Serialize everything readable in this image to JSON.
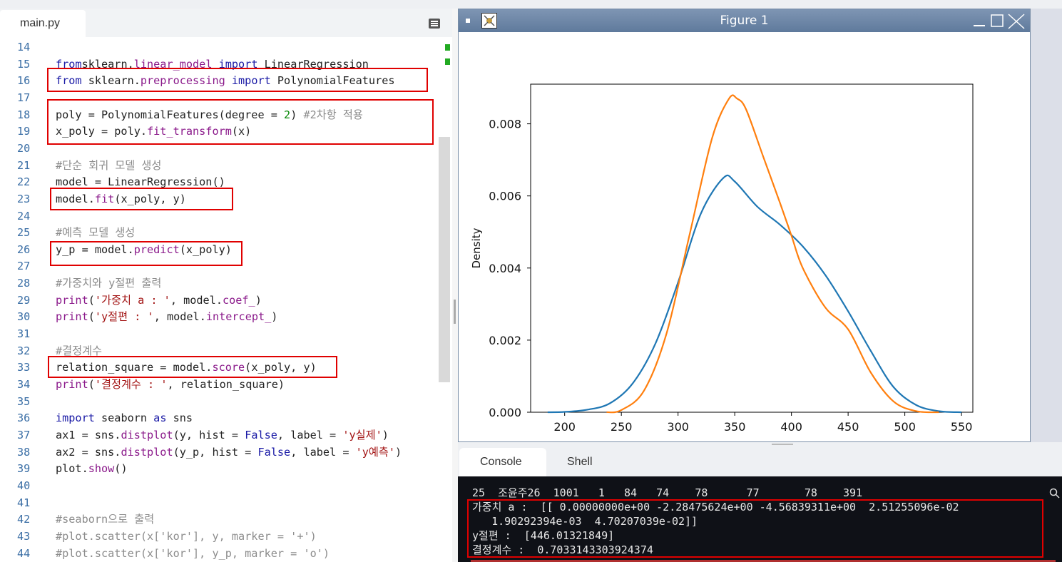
{
  "editor": {
    "tab_label": "main.py",
    "lines": [
      {
        "n": "14",
        "parts": []
      },
      {
        "n": "15",
        "parts": [
          [
            "kw",
            "from"
          ],
          [
            "",
            "sklearn."
          ],
          [
            "fn",
            "linear_model"
          ],
          [
            "",
            ""
          ],
          [
            "kw",
            " import"
          ],
          [
            "",
            " LinearRegression"
          ]
        ]
      },
      {
        "n": "16",
        "parts": [
          [
            "kw",
            "from"
          ],
          [
            "",
            " sklearn."
          ],
          [
            "fn",
            "preprocessing"
          ],
          [
            "kw",
            " import"
          ],
          [
            "",
            " PolynomialFeatures"
          ]
        ]
      },
      {
        "n": "17",
        "parts": []
      },
      {
        "n": "18",
        "parts": [
          [
            "",
            "poly = PolynomialFeatures(degree = "
          ],
          [
            "num",
            "2"
          ],
          [
            "",
            ") "
          ],
          [
            "cm",
            "#2차항 적용"
          ]
        ]
      },
      {
        "n": "19",
        "parts": [
          [
            "",
            "x_poly = poly."
          ],
          [
            "fn",
            "fit_transform"
          ],
          [
            "",
            "(x)"
          ]
        ]
      },
      {
        "n": "20",
        "parts": []
      },
      {
        "n": "21",
        "parts": [
          [
            "cm",
            "#단순 회귀 모델 생성"
          ]
        ]
      },
      {
        "n": "22",
        "parts": [
          [
            "",
            "model = LinearRegression()"
          ]
        ]
      },
      {
        "n": "23",
        "parts": [
          [
            "",
            "model."
          ],
          [
            "fn",
            "fit"
          ],
          [
            "",
            "(x_poly, y)"
          ]
        ]
      },
      {
        "n": "24",
        "parts": []
      },
      {
        "n": "25",
        "parts": [
          [
            "cm",
            "#예측 모델 생성"
          ]
        ]
      },
      {
        "n": "26",
        "parts": [
          [
            "",
            "y_p = model."
          ],
          [
            "fn",
            "predict"
          ],
          [
            "",
            "(x_poly)"
          ]
        ]
      },
      {
        "n": "27",
        "parts": []
      },
      {
        "n": "28",
        "parts": [
          [
            "cm",
            "#가중치와 y절편 출력"
          ]
        ]
      },
      {
        "n": "29",
        "parts": [
          [
            "fn",
            "print"
          ],
          [
            "",
            "("
          ],
          [
            "str",
            "'가중치 a : '"
          ],
          [
            "",
            ", model."
          ],
          [
            "fn",
            "coef_"
          ],
          [
            "",
            ")"
          ]
        ]
      },
      {
        "n": "30",
        "parts": [
          [
            "fn",
            "print"
          ],
          [
            "",
            "("
          ],
          [
            "str",
            "'y절편 : '"
          ],
          [
            "",
            ", model."
          ],
          [
            "fn",
            "intercept_"
          ],
          [
            "",
            ")"
          ]
        ]
      },
      {
        "n": "31",
        "parts": []
      },
      {
        "n": "32",
        "parts": [
          [
            "cm",
            "#결정계수"
          ]
        ]
      },
      {
        "n": "33",
        "parts": [
          [
            "",
            "relation_square = model."
          ],
          [
            "fn",
            "score"
          ],
          [
            "",
            "(x_poly, y)"
          ]
        ]
      },
      {
        "n": "34",
        "parts": [
          [
            "fn",
            "print"
          ],
          [
            "",
            "("
          ],
          [
            "str",
            "'결정계수 : '"
          ],
          [
            "",
            ", relation_square)"
          ]
        ]
      },
      {
        "n": "35",
        "parts": []
      },
      {
        "n": "36",
        "parts": [
          [
            "kw",
            "import"
          ],
          [
            "",
            " seaborn "
          ],
          [
            "kw",
            "as"
          ],
          [
            "",
            " sns"
          ]
        ]
      },
      {
        "n": "37",
        "parts": [
          [
            "",
            "ax1 = sns."
          ],
          [
            "fn",
            "distplot"
          ],
          [
            "",
            "(y, hist = "
          ],
          [
            "kw",
            "False"
          ],
          [
            "",
            ", label = "
          ],
          [
            "str",
            "'y실제'"
          ],
          [
            "",
            ")"
          ]
        ]
      },
      {
        "n": "38",
        "parts": [
          [
            "",
            "ax2 = sns."
          ],
          [
            "fn",
            "distplot"
          ],
          [
            "",
            "(y_p, hist = "
          ],
          [
            "kw",
            "False"
          ],
          [
            "",
            ", label = "
          ],
          [
            "str",
            "'y예측'"
          ],
          [
            "",
            ")"
          ]
        ]
      },
      {
        "n": "39",
        "parts": [
          [
            "",
            "plot."
          ],
          [
            "fn",
            "show"
          ],
          [
            "",
            "()"
          ]
        ]
      },
      {
        "n": "40",
        "parts": []
      },
      {
        "n": "41",
        "parts": []
      },
      {
        "n": "42",
        "parts": [
          [
            "cm",
            "#seaborn으로 출력"
          ]
        ]
      },
      {
        "n": "43",
        "parts": [
          [
            "cm",
            "#plot.scatter(x['kor'], y, marker = '+')"
          ]
        ]
      },
      {
        "n": "44",
        "parts": [
          [
            "cm",
            "#plot.scatter(x['kor'], y_p, marker = 'o')"
          ]
        ]
      }
    ]
  },
  "figure": {
    "window_title": "Figure 1"
  },
  "chart_data": {
    "type": "line",
    "title": "",
    "xlabel": "",
    "ylabel": "Density",
    "xlim": [
      170,
      560
    ],
    "ylim": [
      0,
      0.0091
    ],
    "xticks": [
      "200",
      "250",
      "300",
      "350",
      "400",
      "450",
      "500",
      "550"
    ],
    "yticks": [
      "0.000",
      "0.002",
      "0.004",
      "0.006",
      "0.008"
    ],
    "series": [
      {
        "color": "#1f77b4",
        "x": [
          185,
          200,
          220,
          240,
          260,
          280,
          300,
          320,
          340,
          350,
          370,
          390,
          410,
          430,
          450,
          470,
          490,
          510,
          530,
          550
        ],
        "y": [
          0.0,
          1e-05,
          7e-05,
          0.00025,
          0.0008,
          0.0019,
          0.0036,
          0.0055,
          0.0065,
          0.0064,
          0.0057,
          0.0052,
          0.0046,
          0.0038,
          0.0028,
          0.0017,
          0.0007,
          0.0002,
          3e-05,
          0.0
        ]
      },
      {
        "color": "#ff7f0e",
        "x": [
          237,
          250,
          270,
          290,
          310,
          330,
          345,
          352,
          360,
          375,
          390,
          400,
          410,
          430,
          450,
          470,
          490,
          510,
          530
        ],
        "y": [
          0.0,
          6e-05,
          0.0006,
          0.0022,
          0.0049,
          0.0076,
          0.0087,
          0.0087,
          0.0084,
          0.0071,
          0.0058,
          0.0049,
          0.004,
          0.0029,
          0.0023,
          0.0011,
          0.0003,
          3e-05,
          0.0
        ]
      }
    ],
    "grid": false
  },
  "console": {
    "tabs": [
      {
        "label": "Console"
      },
      {
        "label": "Shell"
      }
    ],
    "lines": [
      "25  조윤주26  1001   1   84   74    78      77       78    391",
      "가중치 a :  [[ 0.00000000e+00 -2.28475624e+00 -4.56839311e+00  2.51255096e-02",
      "   1.90292394e-03  4.70207039e-02]]",
      "y절편 :  [446.01321849]",
      "결정계수 :  0.7033143303924374"
    ]
  }
}
